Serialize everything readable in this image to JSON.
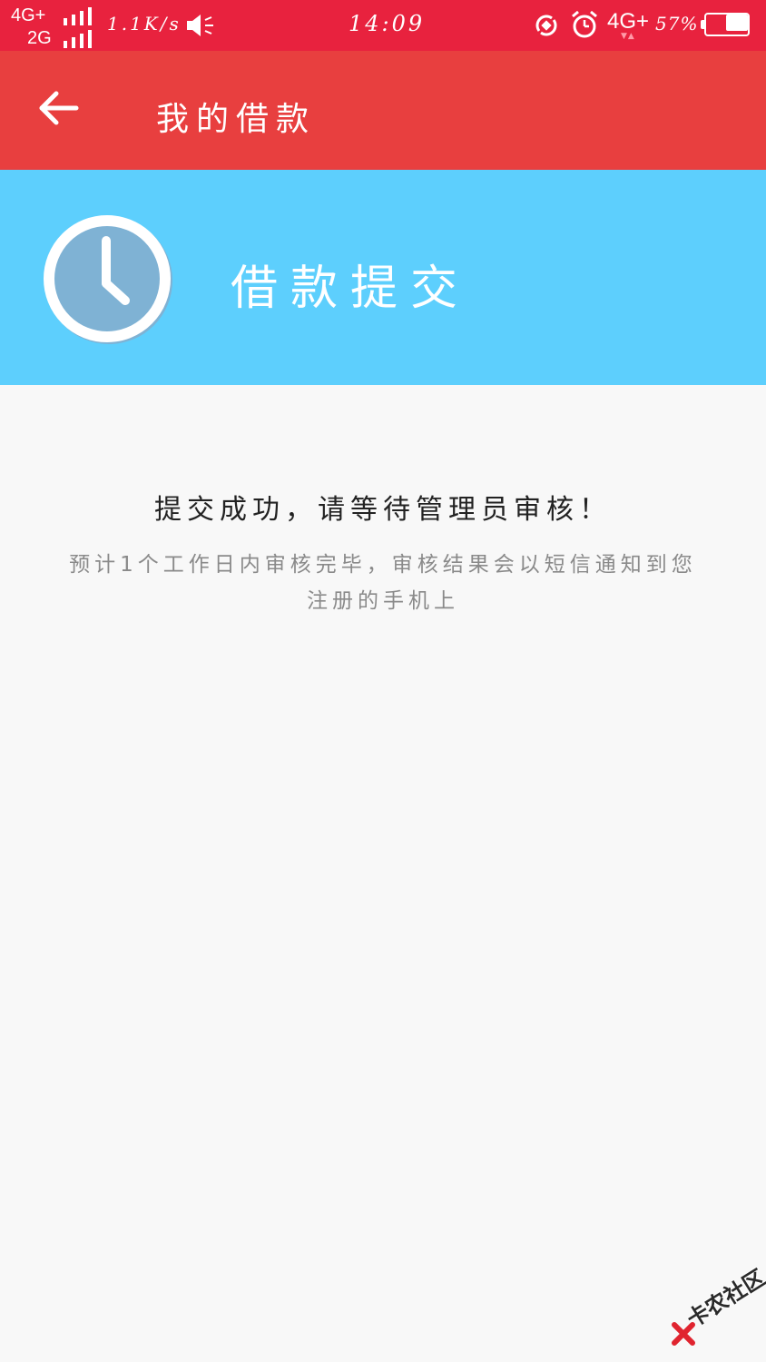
{
  "status_bar": {
    "network_primary": "4G+",
    "network_secondary": "2G",
    "speed": "1.1K/s",
    "time": "14:09",
    "network_right": "4G+",
    "battery_percent": "57%",
    "battery_level": 0.57,
    "colors": {
      "background": "#e8223e"
    }
  },
  "app_bar": {
    "back_icon": "arrow-left-icon",
    "title": "我的借款",
    "colors": {
      "background": "#e83f3f"
    }
  },
  "banner": {
    "icon": "clock-icon",
    "title": "借款提交",
    "colors": {
      "background": "#5dcffd"
    }
  },
  "content": {
    "message": "提交成功，请等待管理员审核！",
    "note": "预计1个工作日内审核完毕，审核结果会以短信通知到您注册的手机上"
  },
  "watermark": {
    "text": "卡农社区"
  }
}
